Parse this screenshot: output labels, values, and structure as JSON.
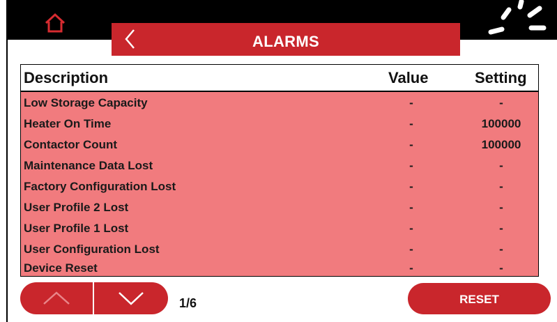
{
  "header": {
    "title": "ALARMS",
    "home_icon": "home-icon",
    "back_icon": "chevron-left-icon",
    "status_icon": "loading-spinner-icon"
  },
  "table": {
    "columns": [
      "Description",
      "Value",
      "Setting"
    ],
    "rows": [
      {
        "description": "Low Storage Capacity",
        "value": "-",
        "setting": "-"
      },
      {
        "description": "Heater On Time",
        "value": "-",
        "setting": "100000"
      },
      {
        "description": "Contactor Count",
        "value": "-",
        "setting": "100000"
      },
      {
        "description": "Maintenance Data Lost",
        "value": "-",
        "setting": "-"
      },
      {
        "description": "Factory Configuration Lost",
        "value": "-",
        "setting": "-"
      },
      {
        "description": "User Profile 2 Lost",
        "value": "-",
        "setting": "-"
      },
      {
        "description": "User Profile 1 Lost",
        "value": "-",
        "setting": "-"
      },
      {
        "description": "User Configuration Lost",
        "value": "-",
        "setting": "-"
      },
      {
        "description": "Device Reset",
        "value": "-",
        "setting": "-"
      }
    ]
  },
  "pagination": {
    "indicator": "1/6",
    "up_icon": "chevron-up-icon",
    "down_icon": "chevron-down-icon"
  },
  "actions": {
    "reset_label": "RESET"
  },
  "colors": {
    "accent": "#c9262c",
    "row_background": "#f17b7e",
    "topbar": "#000000"
  }
}
